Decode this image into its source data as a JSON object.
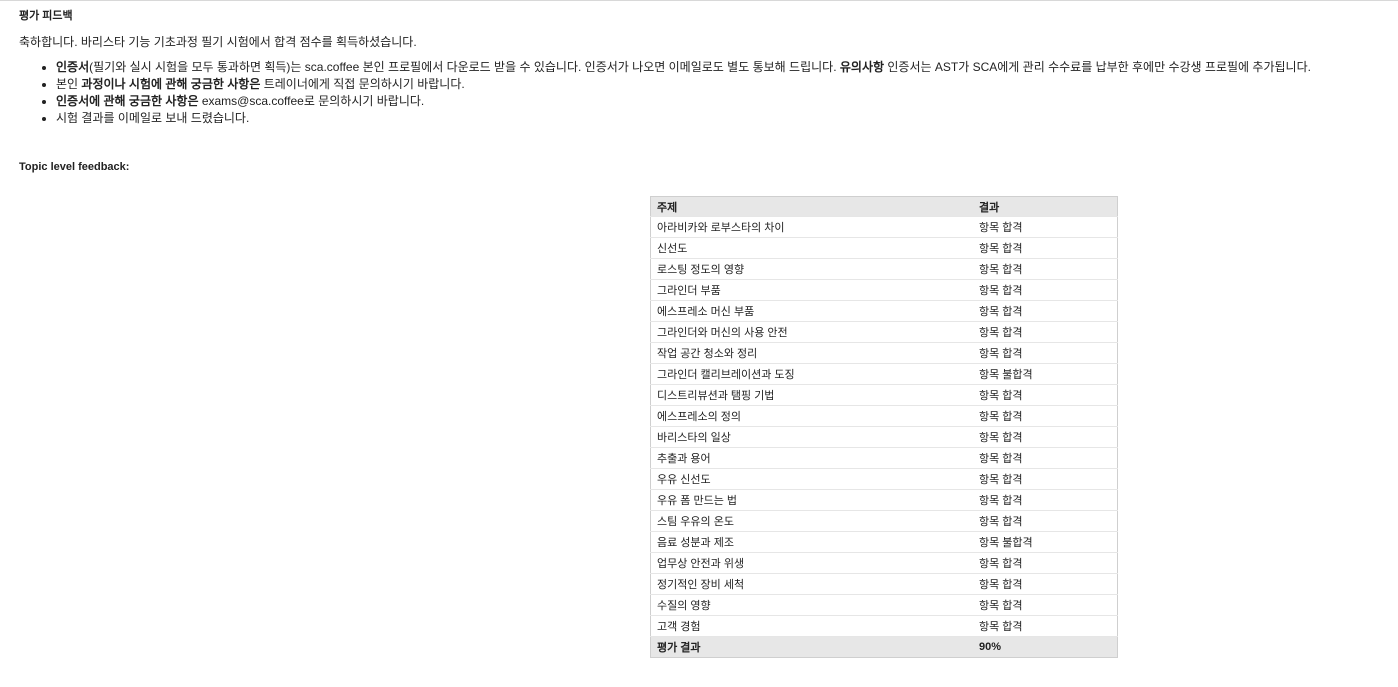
{
  "feedback": {
    "title": "평가 피드백",
    "intro": "축하합니다. 바리스타 기능 기초과정 필기 시험에서 합격 점수를 획득하셨습니다.",
    "notes": [
      {
        "bold1": "인증서",
        "text1": "(필기와 실시 시험을 모두 통과하면 획득)는 sca.coffee 본인 프로필에서 다운로드 받을 수 있습니다. 인증서가 나오면 이메일로도 별도 통보해 드립니다.  ",
        "bold2": "유의사항",
        "text2": " 인증서는 AST가 SCA에게 관리 수수료를 납부한 후에만 수강생 프로필에 추가됩니다."
      },
      {
        "text0": "본인 ",
        "bold1": "과정이나 시험에 관해 궁금한 사항은",
        "text1": " 트레이너에게 직접 문의하시기 바랍니다."
      },
      {
        "bold1": "인증서에 관해 궁금한 사항은",
        "text1": " exams@sca.coffee로 문의하시기 바랍니다."
      },
      {
        "text1": "시험 결과를 이메일로 보내 드렸습니다."
      }
    ]
  },
  "topic_feedback": {
    "title": "Topic level feedback:",
    "table": {
      "headers": [
        "주제",
        "결과"
      ],
      "rows": [
        [
          "아라비카와 로부스타의 차이",
          "항목 합격"
        ],
        [
          "신선도",
          "항목 합격"
        ],
        [
          "로스팅 정도의 영향",
          "항목 합격"
        ],
        [
          "그라인더 부품",
          "항목 합격"
        ],
        [
          "에스프레소 머신 부품",
          "항목 합격"
        ],
        [
          "그라인더와 머신의 사용 안전",
          "항목 합격"
        ],
        [
          "작업 공간 청소와 정리",
          "항목 합격"
        ],
        [
          "그라인더 캘리브레이션과 도징",
          "항목 불합격"
        ],
        [
          "디스트리뷰션과 탬핑 기법",
          "항목 합격"
        ],
        [
          "에스프레소의 정의",
          "항목 합격"
        ],
        [
          "바리스타의 일상",
          "항목 합격"
        ],
        [
          "추출과 용어",
          "항목 합격"
        ],
        [
          "우유 신선도",
          "항목 합격"
        ],
        [
          "우유 폼 만드는 법",
          "항목 합격"
        ],
        [
          "스팀 우유의 온도",
          "항목 합격"
        ],
        [
          "음료 성분과 제조",
          "항목 불합격"
        ],
        [
          "업무상 안전과 위생",
          "항목 합격"
        ],
        [
          "정기적인 장비 세척",
          "항목 합격"
        ],
        [
          "수질의 영향",
          "항목 합격"
        ],
        [
          "고객 경험",
          "항목 합격"
        ]
      ],
      "footer": [
        "평가 결과",
        "90%"
      ]
    }
  }
}
